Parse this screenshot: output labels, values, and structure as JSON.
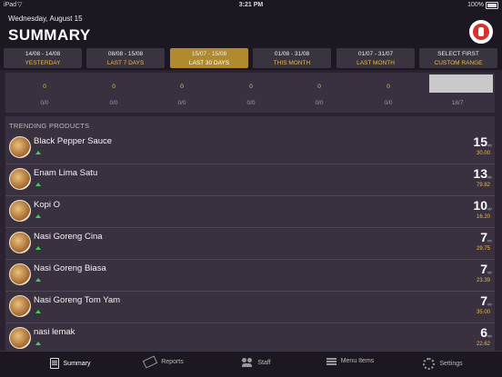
{
  "status_bar": {
    "carrier": "iPad",
    "time": "3:21 PM",
    "battery": "100%"
  },
  "header": {
    "date": "Wednesday, August 15",
    "title": "SUMMARY",
    "avatar_icon": "chef-avatar-icon"
  },
  "ranges": [
    {
      "dates": "14/08 - 14/08",
      "label": "YESTERDAY",
      "active": false
    },
    {
      "dates": "08/08 - 15/08",
      "label": "LAST 7 DAYS",
      "active": false
    },
    {
      "dates": "15/07 - 15/08",
      "label": "LAST 30 DAYS",
      "active": true
    },
    {
      "dates": "01/08 - 31/08",
      "label": "THIS MONTH",
      "active": false
    },
    {
      "dates": "01/07 - 31/07",
      "label": "LAST MONTH",
      "active": false
    },
    {
      "dates": "SELECT FIRST",
      "label": "CUSTOM RANGE",
      "active": false
    }
  ],
  "summary": {
    "values": [
      "0",
      "0",
      "0",
      "0",
      "0",
      "0"
    ],
    "subs": [
      "0/0",
      "0/0",
      "0/0",
      "0/0",
      "0/0",
      "0/0",
      "18/7"
    ]
  },
  "trending": {
    "title": "TRENDING PRODUCTS",
    "unit": "qty",
    "items": [
      {
        "name": "Black Pepper Sauce",
        "qty": "15",
        "amount": "30.00"
      },
      {
        "name": "Enam Lima Satu",
        "qty": "13",
        "amount": "79.82"
      },
      {
        "name": "Kopi O",
        "qty": "10",
        "amount": "16.20"
      },
      {
        "name": "Nasi Goreng Cina",
        "qty": "7",
        "amount": "29.75"
      },
      {
        "name": "Nasi Goreng Biasa",
        "qty": "7",
        "amount": "23.39"
      },
      {
        "name": "Nasi Goreng Tom Yam",
        "qty": "7",
        "amount": "35.00"
      },
      {
        "name": "nasi lemak",
        "qty": "6",
        "amount": "22.62"
      }
    ]
  },
  "tabs": [
    {
      "label": "Summary",
      "icon": "summary-icon",
      "active": true
    },
    {
      "label": "Reports",
      "icon": "reports-icon",
      "active": false
    },
    {
      "label": "Staff",
      "icon": "staff-icon",
      "active": false
    },
    {
      "label": "Menu Items",
      "icon": "menu-items-icon",
      "active": false
    },
    {
      "label": "Settings",
      "icon": "settings-icon",
      "active": false
    }
  ],
  "colors": {
    "accent": "#e8b94a",
    "active_range": "#b08a2c",
    "trend_up": "#3ccf5a",
    "background": "#2a2230"
  }
}
